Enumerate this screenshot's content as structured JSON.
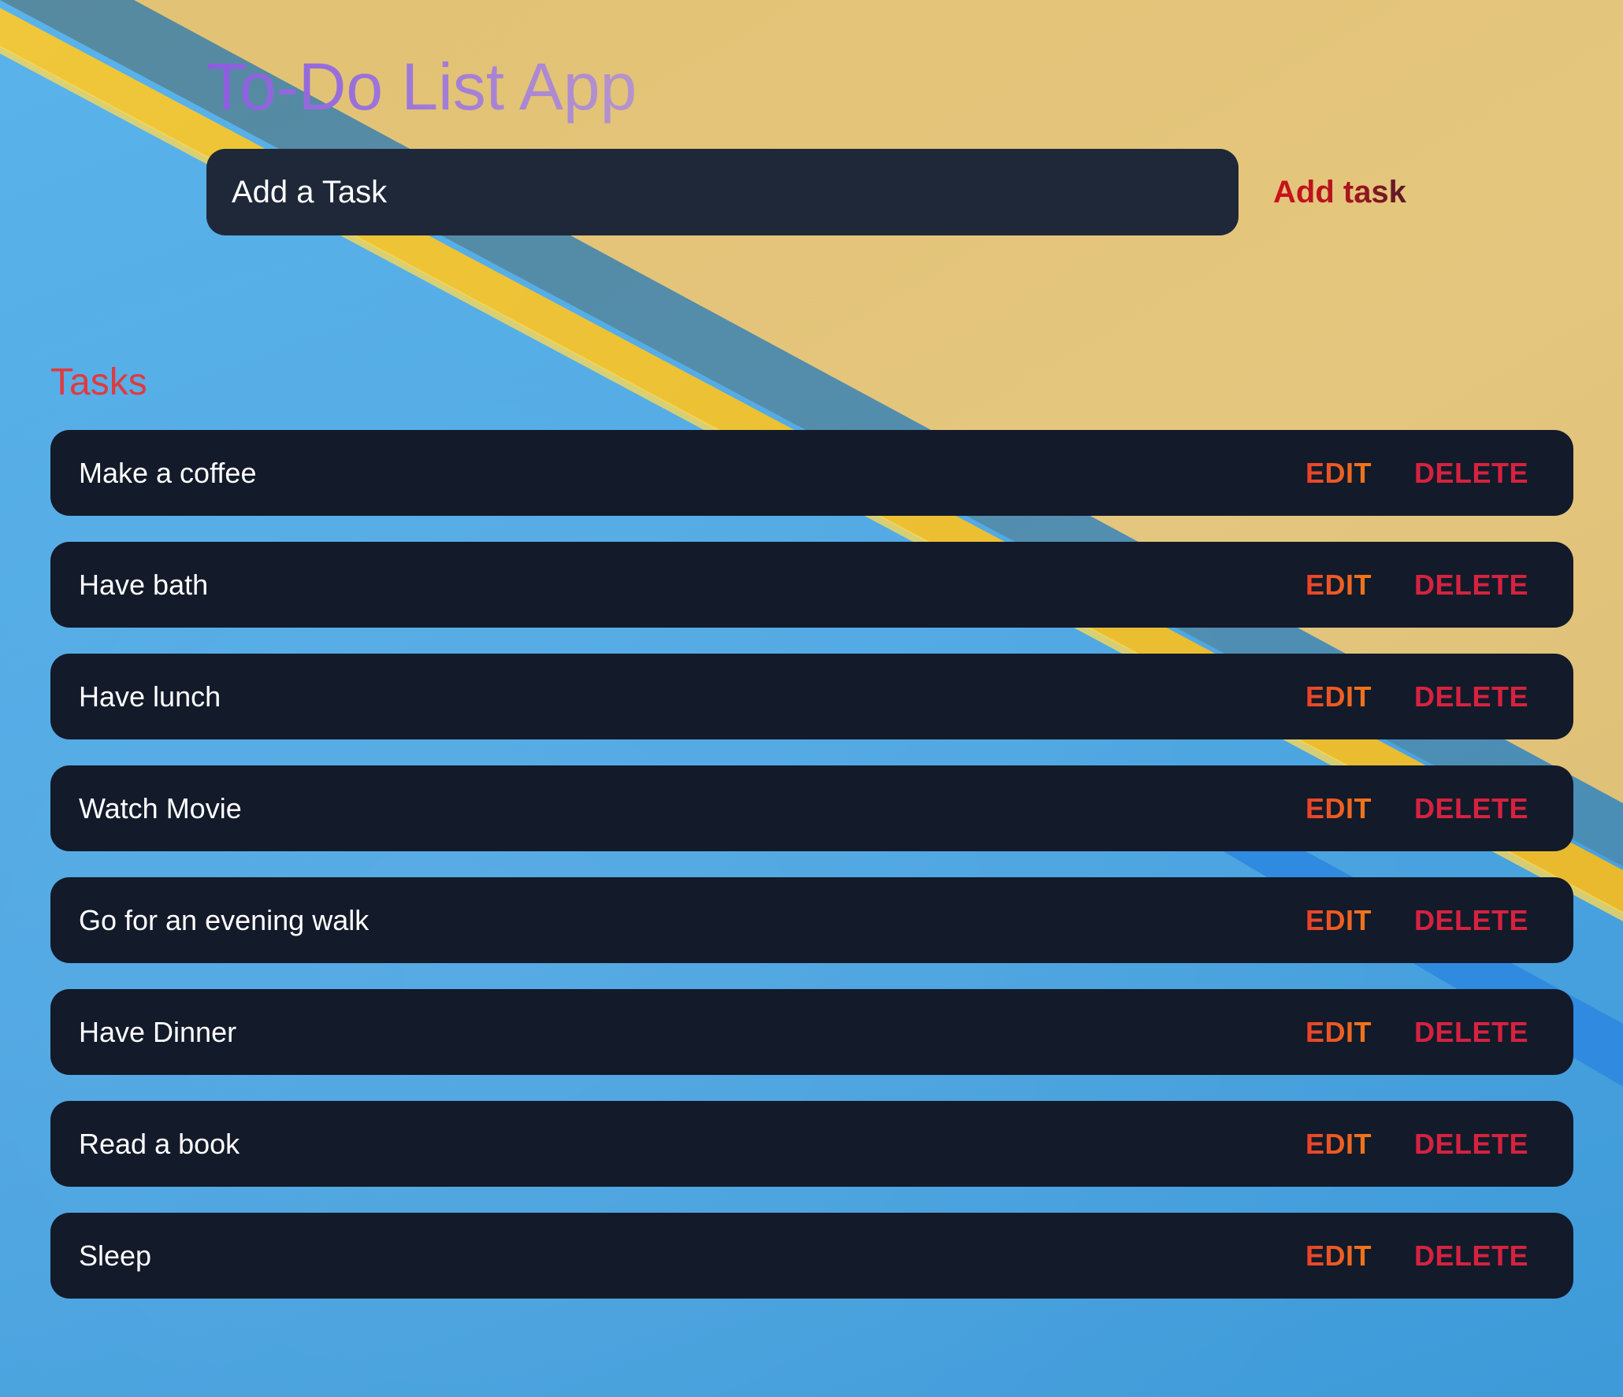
{
  "app": {
    "title": "To-Do List App"
  },
  "add_form": {
    "input_placeholder": "Add a Task",
    "input_value": "",
    "button_label": "Add task"
  },
  "tasks_section": {
    "heading": "Tasks",
    "edit_label": "EDIT",
    "delete_label": "DELETE",
    "items": [
      {
        "text": "Make a coffee"
      },
      {
        "text": "Have bath"
      },
      {
        "text": "Have lunch"
      },
      {
        "text": "Watch Movie"
      },
      {
        "text": "Go for an evening walk"
      },
      {
        "text": "Have Dinner"
      },
      {
        "text": "Read a book"
      },
      {
        "text": "Sleep"
      }
    ]
  },
  "colors": {
    "input_background": "#1f2839",
    "task_background": "#131a2a",
    "heading_color": "#e03a3f",
    "delete_color": "#d6223f",
    "edit_color": "#f07a1a"
  }
}
